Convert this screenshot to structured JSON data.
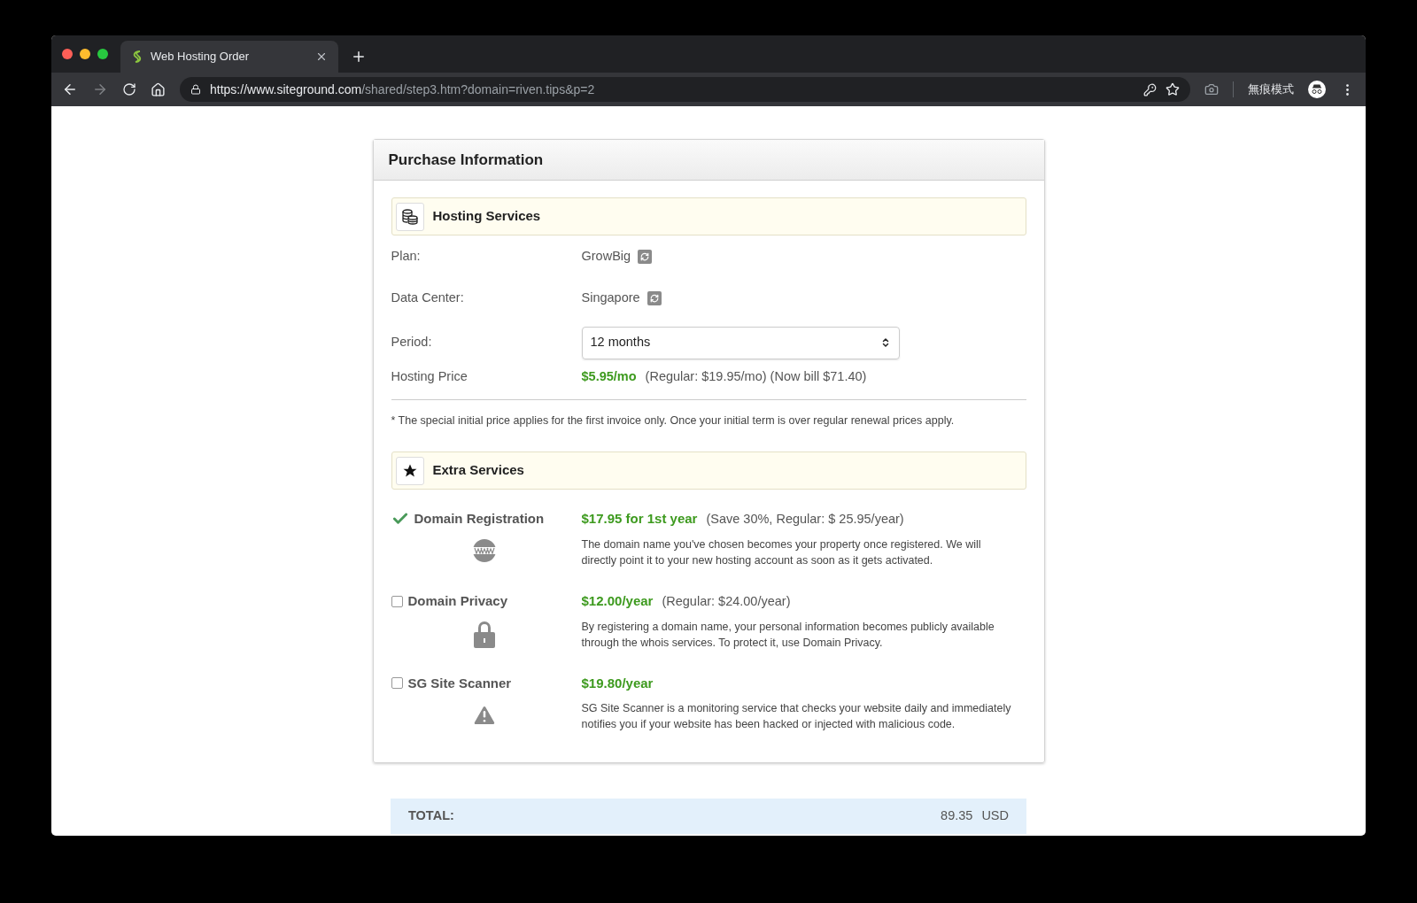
{
  "browser": {
    "tab": {
      "title": "Web Hosting Order",
      "selected": true
    },
    "url": {
      "host": "https://www.siteground.com",
      "path": "/shared/step3.htm?domain=riven.tips&p=2"
    },
    "profile_label": "無痕模式"
  },
  "card": {
    "title": "Purchase Information",
    "hosting": {
      "heading": "Hosting Services",
      "rows": [
        {
          "kind": "text",
          "label": "Plan:",
          "value": "GrowBig"
        },
        {
          "kind": "text",
          "label": "Data Center:",
          "value": "Singapore"
        },
        {
          "kind": "select",
          "label": "Period:",
          "value": "12 months"
        },
        {
          "kind": "price",
          "label": "Hosting Price",
          "price": "$5.95/mo",
          "note": "(Regular: $19.95/mo) (Now bill $71.40)"
        }
      ],
      "footnote": "* The special initial price applies for the first invoice only. Once your initial term is over regular renewal prices apply."
    },
    "extras": {
      "heading": "Extra Services",
      "items": [
        {
          "kind": "www",
          "name": "Domain Registration",
          "checked": true,
          "price": "$17.95 for 1st year",
          "note": "(Save 30%, Regular: $ 25.95/year)",
          "description": "The domain name you've chosen becomes your property once registered. We will directly point it to your new hosting account as soon as it gets activated."
        },
        {
          "kind": "lock",
          "name": "Domain Privacy",
          "checked": false,
          "price": "$12.00/year",
          "note": "(Regular: $24.00/year)",
          "description": "By registering a domain name, your personal information becomes publicly available through the whois services. To protect it, use Domain Privacy."
        },
        {
          "kind": "warning",
          "name": "SG Site Scanner",
          "checked": false,
          "price": "$19.80/year",
          "description": "SG Site Scanner is a monitoring service that checks your website daily and immediately notifies you if your website has been hacked or injected with malicious code."
        }
      ]
    }
  },
  "total": {
    "label": "TOTAL:",
    "amount": "89.35",
    "currency": "USD"
  }
}
